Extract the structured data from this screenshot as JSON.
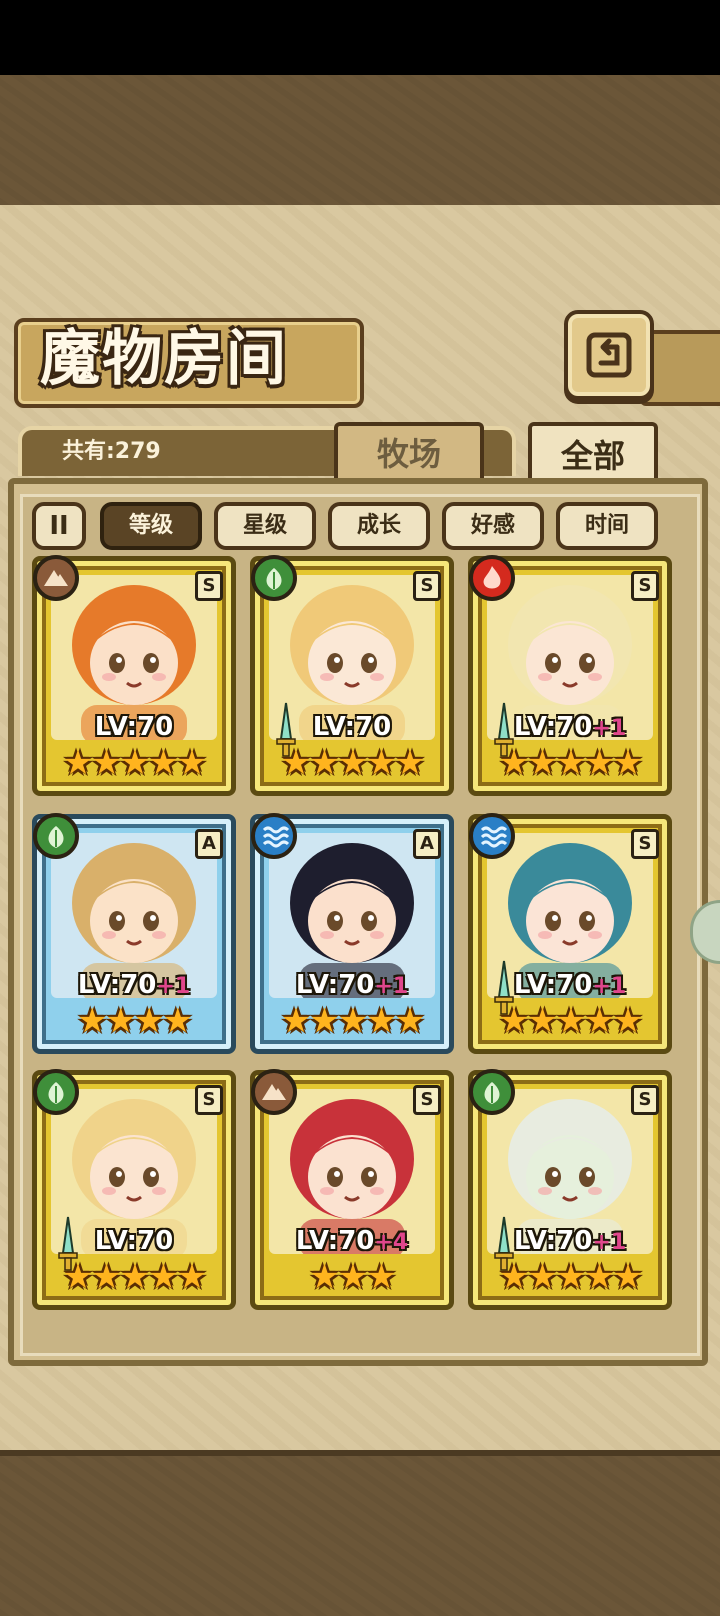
{
  "header": {
    "title": "魔物房间",
    "count_label": "共有:279"
  },
  "tabs": [
    {
      "label": "牧场",
      "active": false
    },
    {
      "label": "全部",
      "active": true
    }
  ],
  "filters": {
    "sort_toggle": "II",
    "chips": [
      {
        "label": "等级",
        "active": true
      },
      {
        "label": "星级",
        "active": false
      },
      {
        "label": "成长",
        "active": false
      },
      {
        "label": "好感",
        "active": false
      },
      {
        "label": "时间",
        "active": false
      }
    ]
  },
  "cards": [
    {
      "element": "earth",
      "rank": "S",
      "frame": "gold",
      "level": "LV:70",
      "plus": "",
      "stars": 5,
      "weapon": false,
      "hair": "#e67a2a",
      "skin": "#fbe0c8"
    },
    {
      "element": "wind",
      "rank": "S",
      "frame": "gold",
      "level": "LV:70",
      "plus": "",
      "stars": 5,
      "weapon": true,
      "hair": "#f0c978",
      "skin": "#fbe8d6"
    },
    {
      "element": "fire",
      "rank": "S",
      "frame": "gold",
      "level": "LV:70",
      "plus": "+1",
      "stars": 5,
      "weapon": true,
      "hair": "#f2e6b0",
      "skin": "#fbe6d4"
    },
    {
      "element": "wind",
      "rank": "A",
      "frame": "blue",
      "level": "LV:70",
      "plus": "+1",
      "stars": 4,
      "weapon": false,
      "hair": "#d9b06a",
      "skin": "#fbe2c8"
    },
    {
      "element": "water",
      "rank": "A",
      "frame": "blue",
      "level": "LV:70",
      "plus": "+1",
      "stars": 5,
      "weapon": false,
      "hair": "#1e1e2e",
      "skin": "#fbe0cc"
    },
    {
      "element": "water",
      "rank": "S",
      "frame": "gold",
      "level": "LV:70",
      "plus": "+1",
      "stars": 5,
      "weapon": true,
      "hair": "#3a8a9a",
      "skin": "#fbe4d6"
    },
    {
      "element": "wind",
      "rank": "S",
      "frame": "gold",
      "level": "LV:70",
      "plus": "",
      "stars": 5,
      "weapon": true,
      "hair": "#f0d38a",
      "skin": "#fbe4d0"
    },
    {
      "element": "earth",
      "rank": "S",
      "frame": "gold",
      "level": "LV:70",
      "plus": "+4",
      "stars": 3,
      "weapon": false,
      "hair": "#c8323a",
      "skin": "#fbe2d0"
    },
    {
      "element": "wind",
      "rank": "S",
      "frame": "gold",
      "level": "LV:70",
      "plus": "+1",
      "stars": 5,
      "weapon": true,
      "hair": "#e8ece0",
      "skin": "#e6f0dc"
    }
  ],
  "colors": {
    "earth": "#8a5a3a",
    "wind": "#3f8f3a",
    "fire": "#d42a1e",
    "water": "#2a7fc6"
  }
}
